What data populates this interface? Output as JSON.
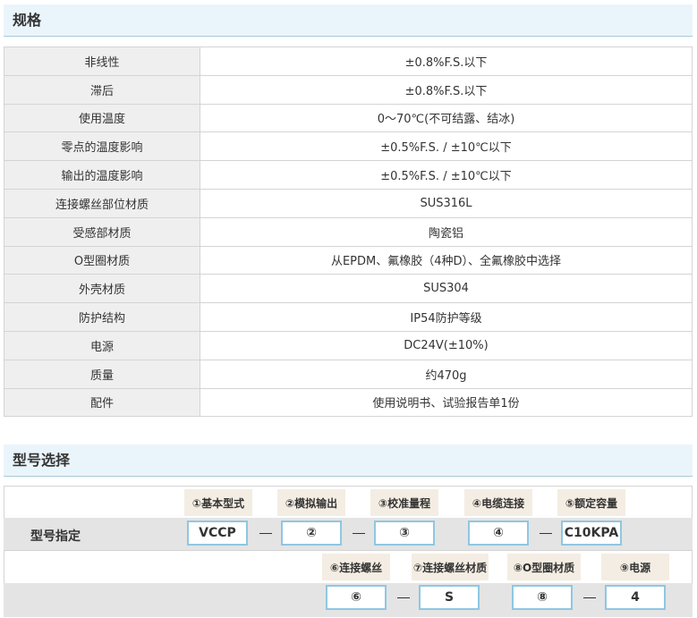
{
  "spec": {
    "title": "规格",
    "rows": [
      {
        "label": "非线性",
        "value": "±0.8%F.S.以下"
      },
      {
        "label": "滞后",
        "value": "±0.8%F.S.以下"
      },
      {
        "label": "使用温度",
        "value": "0～70℃(不可结露、结冰)"
      },
      {
        "label": "零点的温度影响",
        "value": "±0.5%F.S. / ±10℃以下"
      },
      {
        "label": "输出的温度影响",
        "value": "±0.5%F.S. / ±10℃以下"
      },
      {
        "label": "连接螺丝部位材质",
        "value": "SUS316L"
      },
      {
        "label": "受感部材质",
        "value": "陶瓷铝"
      },
      {
        "label": "O型圈材质",
        "value": "从EPDM、氟橡胶（4种D）、全氟橡胶中选择"
      },
      {
        "label": "外壳材质",
        "value": "SUS304"
      },
      {
        "label": "防护结构",
        "value": "IP54防护等级"
      },
      {
        "label": "电源",
        "value": "DC24V(±10%)"
      },
      {
        "label": "质量",
        "value": "约470g"
      },
      {
        "label": "配件",
        "value": "使用说明书、试验报告单1份"
      }
    ]
  },
  "model": {
    "title": "型号选择",
    "designation_label": "型号指定",
    "row1": [
      {
        "label": "①基本型式",
        "code": "VCCP"
      },
      {
        "label": "②模拟输出",
        "code": "②"
      },
      {
        "label": "③校准量程",
        "code": "③"
      },
      {
        "label": "④电缆连接",
        "code": "④"
      },
      {
        "label": "⑤额定容量",
        "code": "C10KPA"
      }
    ],
    "row2": [
      {
        "label": "⑥连接螺丝",
        "code": "⑥"
      },
      {
        "label": "⑦连接螺丝材质",
        "code": "S"
      },
      {
        "label": "⑧O型圈材质",
        "code": "⑧"
      },
      {
        "label": "⑨电源",
        "code": "4"
      }
    ]
  }
}
